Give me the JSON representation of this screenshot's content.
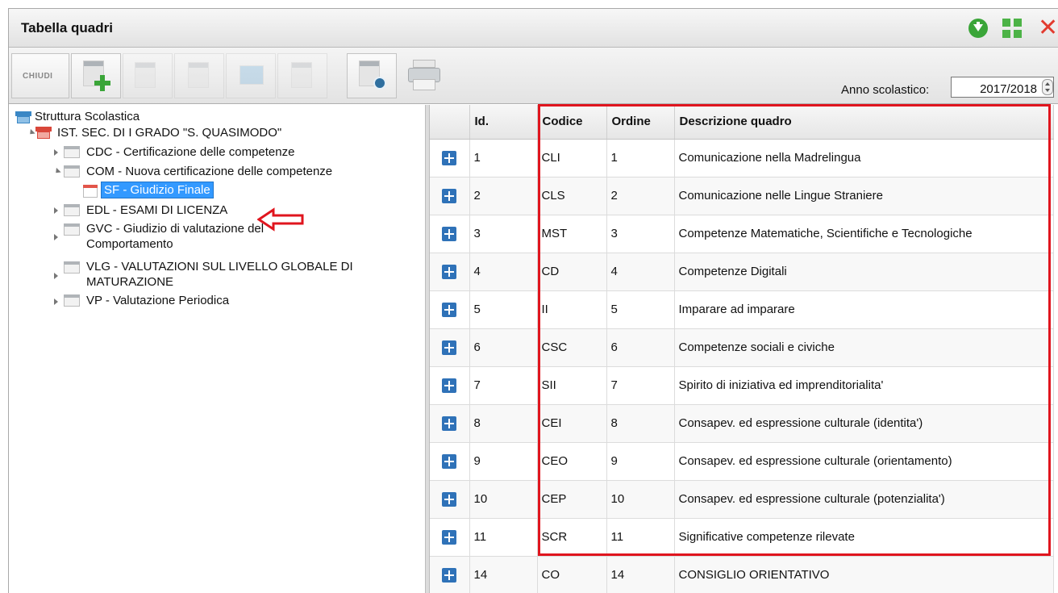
{
  "window": {
    "title": "Tabella quadri"
  },
  "toolbar": {
    "close_label": "CHIUDI",
    "year_label": "Anno scolastico:",
    "year_value": "2017/2018"
  },
  "tree": {
    "root": "Struttura Scolastica",
    "school": "IST. SEC. DI I GRADO \"S. QUASIMODO\"",
    "items": [
      {
        "label": "CDC - Certificazione delle competenze"
      },
      {
        "label": "COM - Nuova certificazione delle competenze",
        "child": "SF - Giudizio Finale"
      },
      {
        "label": "EDL - ESAMI DI LICENZA"
      },
      {
        "label1": "GVC - Giudizio di valutazione del",
        "label2": "Comportamento"
      },
      {
        "label1": "VLG - VALUTAZIONI SUL LIVELLO GLOBALE DI",
        "label2": "MATURAZIONE"
      },
      {
        "label": "VP - Valutazione Periodica"
      }
    ]
  },
  "grid": {
    "columns": [
      "Id.",
      "Codice",
      "Ordine",
      "Descrizione quadro"
    ],
    "rows": [
      [
        "1",
        "CLI",
        "1",
        "Comunicazione nella Madrelingua"
      ],
      [
        "2",
        "CLS",
        "2",
        "Comunicazione nelle Lingue Straniere"
      ],
      [
        "3",
        "MST",
        "3",
        "Competenze Matematiche, Scientifiche e Tecnologiche"
      ],
      [
        "4",
        "CD",
        "4",
        "Competenze Digitali"
      ],
      [
        "5",
        "II",
        "5",
        "Imparare ad imparare"
      ],
      [
        "6",
        "CSC",
        "6",
        "Competenze sociali e civiche"
      ],
      [
        "7",
        "SII",
        "7",
        "Spirito di iniziativa ed imprenditorialita'"
      ],
      [
        "8",
        "CEI",
        "8",
        "Consapev. ed espressione culturale (identita')"
      ],
      [
        "9",
        "CEO",
        "9",
        "Consapev. ed espressione culturale (orientamento)"
      ],
      [
        "10",
        "CEP",
        "10",
        "Consapev. ed espressione culturale (potenzialita')"
      ],
      [
        "11",
        "SCR",
        "11",
        "Significative competenze rilevate"
      ],
      [
        "14",
        "CO",
        "14",
        "CONSIGLIO ORIENTATIVO"
      ]
    ]
  },
  "colors": {
    "annotation": "#e0151e",
    "selection": "#3399ff",
    "accent": "#3aa538"
  }
}
